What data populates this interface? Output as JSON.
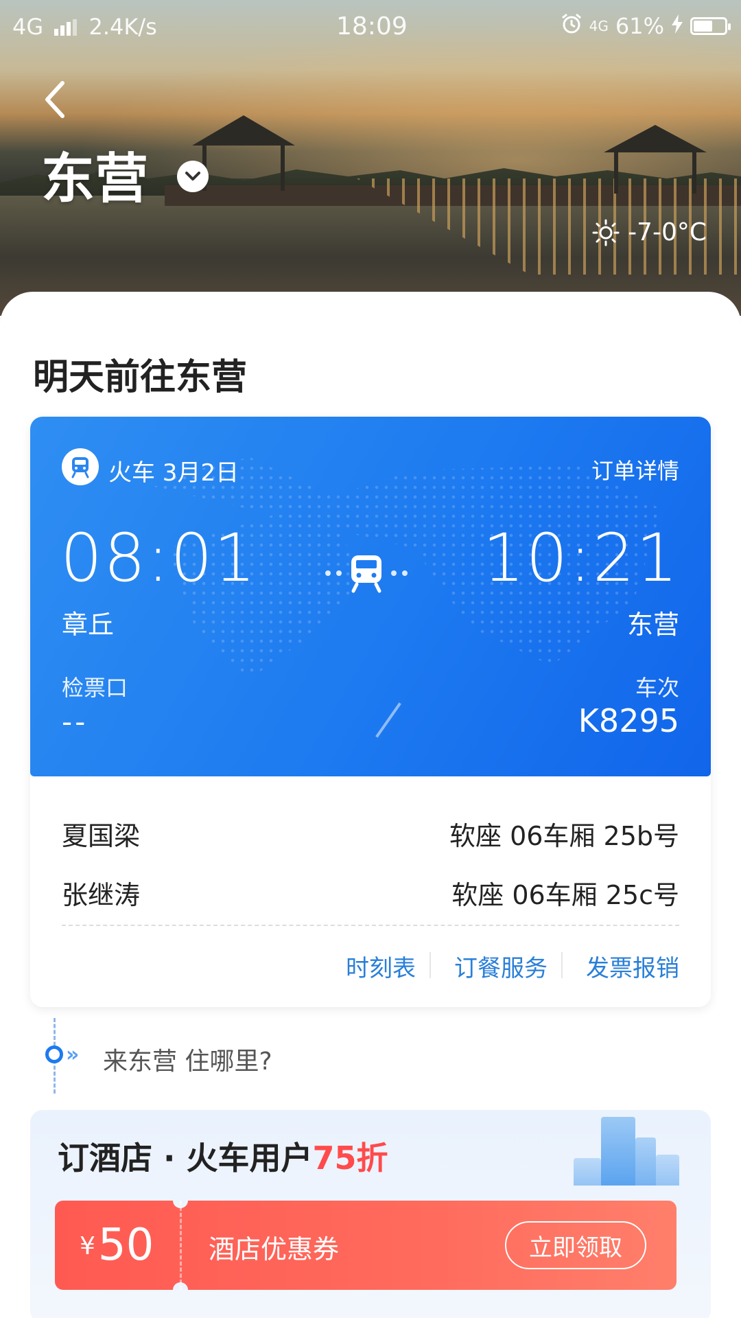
{
  "status_bar": {
    "network": "4G",
    "speed": "2.4K/s",
    "time": "18:09",
    "network_right": "4G",
    "battery": "61%",
    "battery_level": 0.61
  },
  "header": {
    "city": "东营",
    "weather": "-7-0°C"
  },
  "section_title": "明天前往东营",
  "ticket": {
    "type_date": "火车 3月2日",
    "order_detail": "订单详情",
    "dep_time": "08:01",
    "arr_time": "10:21",
    "dep_station": "章丘",
    "arr_station": "东营",
    "gate_label": "检票口",
    "gate_value": "--",
    "train_no_label": "车次",
    "train_no": "K8295",
    "passengers": [
      {
        "name": "夏国梁",
        "seat": "软座 06车厢 25b号"
      },
      {
        "name": "张继涛",
        "seat": "软座 06车厢 25c号"
      }
    ],
    "actions": [
      "时刻表",
      "订餐服务",
      "发票报销"
    ]
  },
  "hotel_prompt": "来东营 住哪里?",
  "promo": {
    "title": "订酒店 · 火车用户",
    "highlight": "75折",
    "coupon_currency": "¥",
    "coupon_amount": "50",
    "coupon_title": "酒店优惠券",
    "claim_label": "立即领取"
  },
  "colors": {
    "accent": "#1d7af0",
    "link": "#2a7fd8",
    "promo_red": "#ff5a52",
    "highlight_red": "#ff4b4b"
  }
}
